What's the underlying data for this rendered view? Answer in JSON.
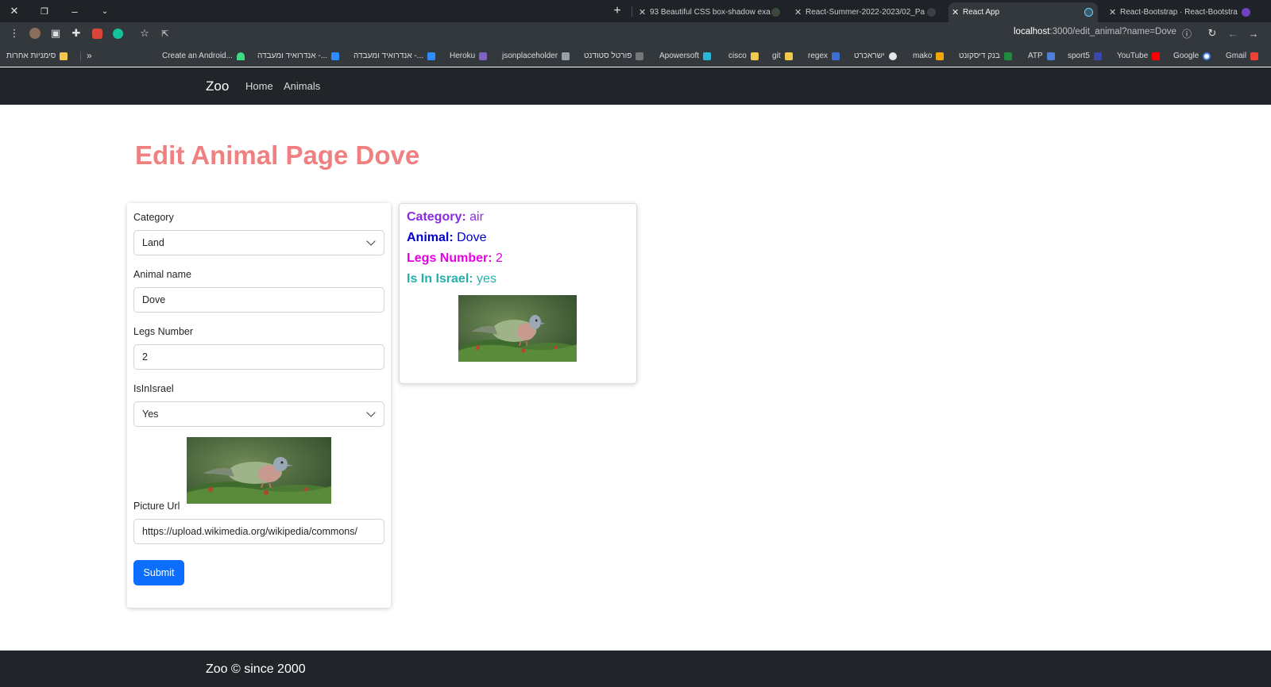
{
  "browser": {
    "tabs": [
      {
        "title": "93 Beautiful CSS box-shadow exa"
      },
      {
        "title": "React-Summer-2022-2023/02_Pa"
      },
      {
        "title": "React App"
      },
      {
        "title": "React-Bootstrap · React-Bootstra"
      }
    ],
    "address": {
      "host": "localhost",
      "path": ":3000/edit_animal?name=Dove"
    },
    "bookmarks": [
      "סימניות אחרות",
      "Create an Android...",
      "אנדרואיד ומעבדה -...",
      "אנדרואיד ומעבדה -...",
      "Heroku",
      "jsonplaceholder",
      "פורטל סטודנט",
      "Apowersoft",
      "cisco",
      "git",
      "regex",
      "ישראכרט",
      "mako",
      "בנק דיסקונט",
      "ATP",
      "sport5",
      "YouTube",
      "Google",
      "Gmail"
    ]
  },
  "navbar": {
    "brand": "Zoo",
    "links": [
      "Home",
      "Animals"
    ]
  },
  "page": {
    "title": "Edit Animal Page Dove"
  },
  "form": {
    "category_label": "Category",
    "category_value": "Land",
    "name_label": "Animal name",
    "name_value": "Dove",
    "legs_label": "Legs Number",
    "legs_value": "2",
    "israel_label": "IsInIsrael",
    "israel_value": "Yes",
    "picture_label": "Picture Url",
    "picture_value": "https://upload.wikimedia.org/wikipedia/commons/",
    "submit_label": "Submit"
  },
  "preview": {
    "category_key": "Category:",
    "category_val": "air",
    "category_color": "#8a2be2",
    "animal_key": "Animal:",
    "animal_val": "Dove",
    "animal_color": "#0000cd",
    "legs_key": "Legs Number:",
    "legs_val": "2",
    "legs_color": "#e600e6",
    "israel_key": "Is In Israel:",
    "israel_val": "yes",
    "israel_color": "#20b2aa"
  },
  "footer": {
    "text": "Zoo © since 2000"
  }
}
